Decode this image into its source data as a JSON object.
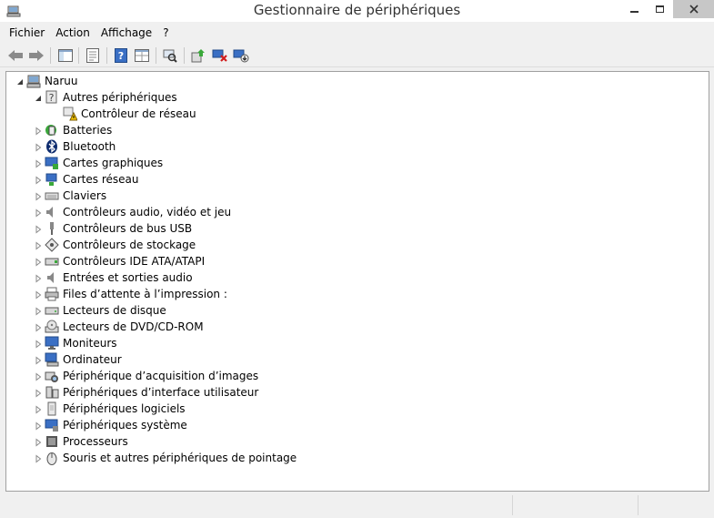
{
  "window": {
    "title": "Gestionnaire de périphériques",
    "close_color": "#c7c7c7"
  },
  "menubar": {
    "items": [
      "Fichier",
      "Action",
      "Affichage",
      "?"
    ]
  },
  "toolbar": {
    "buttons": [
      "back-arrow",
      "forward-arrow",
      "show-hide-console-tree",
      "properties",
      "help",
      "view-pane",
      "scan-hardware-changes",
      "update-driver",
      "uninstall-device",
      "disable-device"
    ]
  },
  "tree": {
    "root": "Naruu",
    "categories": [
      {
        "label": "Autres périphériques",
        "expanded": true,
        "children": [
          "Contrôleur de réseau"
        ]
      },
      {
        "label": "Batteries"
      },
      {
        "label": "Bluetooth"
      },
      {
        "label": "Cartes graphiques"
      },
      {
        "label": "Cartes réseau"
      },
      {
        "label": "Claviers"
      },
      {
        "label": "Contrôleurs audio, vidéo et jeu"
      },
      {
        "label": "Contrôleurs de bus USB"
      },
      {
        "label": "Contrôleurs de stockage"
      },
      {
        "label": "Contrôleurs IDE ATA/ATAPI"
      },
      {
        "label": "Entrées et sorties audio"
      },
      {
        "label": "Files d’attente à l’impression :"
      },
      {
        "label": "Lecteurs de disque"
      },
      {
        "label": "Lecteurs de DVD/CD-ROM"
      },
      {
        "label": "Moniteurs"
      },
      {
        "label": "Ordinateur"
      },
      {
        "label": "Périphérique d’acquisition d’images"
      },
      {
        "label": "Périphériques d’interface utilisateur"
      },
      {
        "label": "Périphériques logiciels"
      },
      {
        "label": "Périphériques système"
      },
      {
        "label": "Processeurs"
      },
      {
        "label": "Souris et autres périphériques de pointage"
      }
    ]
  }
}
